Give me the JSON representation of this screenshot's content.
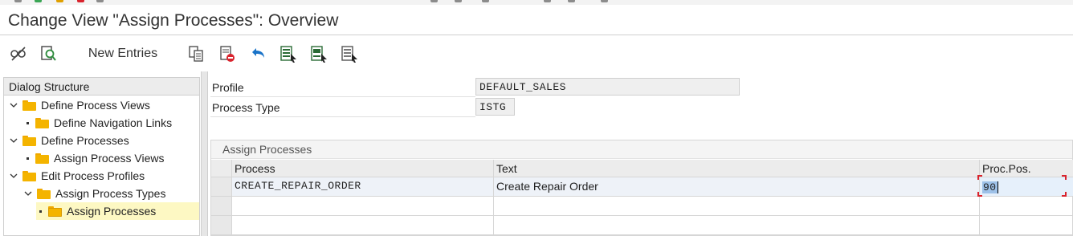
{
  "window": {
    "title": "Change View \"Assign Processes\": Overview"
  },
  "toolbar": {
    "buttons": [
      {
        "name": "display-change-icon"
      },
      {
        "name": "find-icon"
      },
      {
        "name": "copy-as-icon"
      },
      {
        "name": "delete-icon"
      },
      {
        "name": "undo-icon"
      },
      {
        "name": "select-all-icon"
      },
      {
        "name": "select-block-icon"
      },
      {
        "name": "deselect-all-icon"
      }
    ],
    "new_entries_label": "New Entries"
  },
  "dialog_structure": {
    "title": "Dialog Structure",
    "items": [
      {
        "label": "Define Process Views",
        "level": 0,
        "expanded": true
      },
      {
        "label": "Define Navigation Links",
        "level": 1
      },
      {
        "label": "Define Processes",
        "level": 0,
        "expanded": true
      },
      {
        "label": "Assign Process Views",
        "level": 1
      },
      {
        "label": "Edit Process Profiles",
        "level": 0,
        "expanded": true
      },
      {
        "label": "Assign Process Types",
        "level": 1,
        "expanded": true
      },
      {
        "label": "Assign Processes",
        "level": 2,
        "selected": true
      }
    ]
  },
  "header_fields": {
    "profile_label": "Profile",
    "profile_value": "DEFAULT_SALES",
    "process_type_label": "Process Type",
    "process_type_value": "ISTG"
  },
  "assign_processes": {
    "section_title": "Assign Processes",
    "columns": [
      "Process",
      "Text",
      "Proc.Pos."
    ],
    "rows": [
      {
        "process": "CREATE_REPAIR_ORDER",
        "text": "Create Repair Order",
        "proc_pos": "90"
      },
      {
        "process": "",
        "text": "",
        "proc_pos": ""
      },
      {
        "process": "",
        "text": "",
        "proc_pos": ""
      }
    ]
  },
  "colors": {
    "folder": "#f4b400",
    "selection_highlight": "#fdf8c3",
    "input_selection": "#9ec1e8",
    "edit_marker": "#d9232d",
    "undo_icon": "#1a73c8"
  }
}
